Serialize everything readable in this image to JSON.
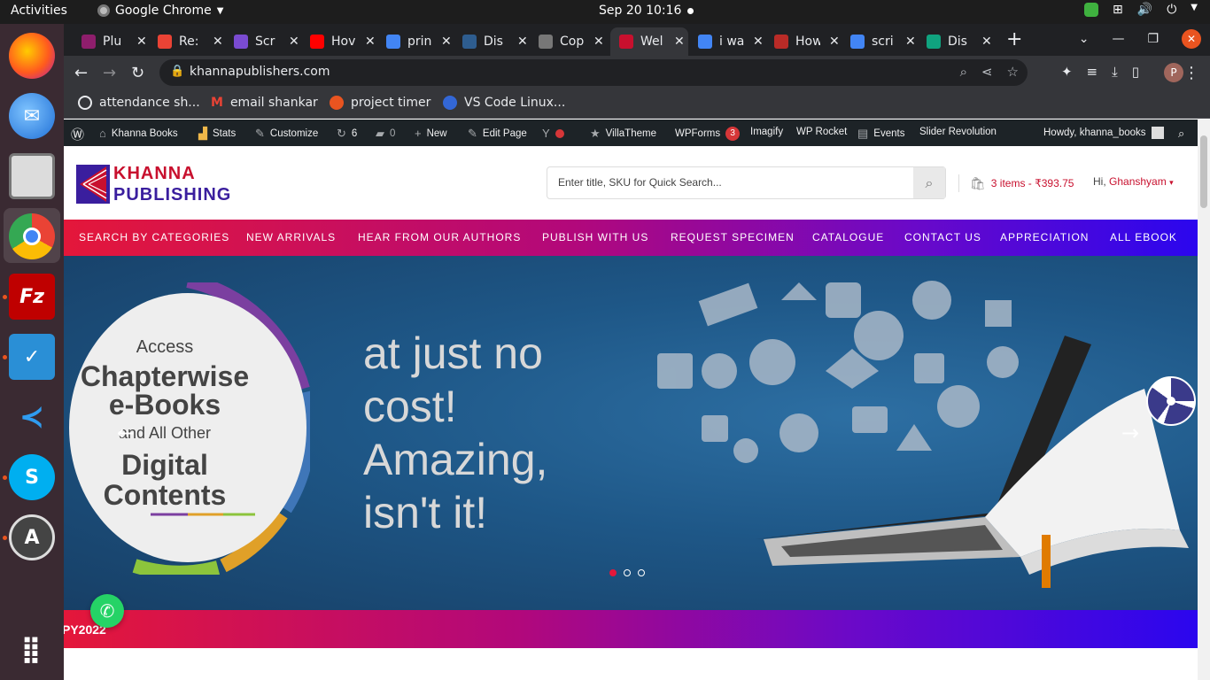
{
  "topbar": {
    "activities": "Activities",
    "app_name": "Google Chrome",
    "datetime": "Sep 20  10:16"
  },
  "tabs": [
    {
      "title": "Plu",
      "color": "#8e1e6c"
    },
    {
      "title": "Re:",
      "color": "#ea4335"
    },
    {
      "title": "Scr",
      "color": "#7a4bd1"
    },
    {
      "title": "Hov",
      "color": "#ff0000"
    },
    {
      "title": "prin",
      "color": "#4285f4"
    },
    {
      "title": "Dis",
      "color": "#2e5d8f"
    },
    {
      "title": "Cop",
      "color": "#777777"
    },
    {
      "title": "Wel",
      "color": "#c8102e"
    },
    {
      "title": "i wa",
      "color": "#4285f4"
    },
    {
      "title": "How",
      "color": "#b92b27"
    },
    {
      "title": "scri",
      "color": "#4285f4"
    },
    {
      "title": "Dis",
      "color": "#10a37f"
    }
  ],
  "toolbar": {
    "url": "khannapublishers.com",
    "profile_initial": "P"
  },
  "bookmarks": [
    {
      "label": "attendance sh...",
      "color": "#e8eaed"
    },
    {
      "label": "email shankar",
      "color": "#ea4335"
    },
    {
      "label": "project timer",
      "color": "#e95420"
    },
    {
      "label": "VS Code Linux...",
      "color": "#3367d6"
    }
  ],
  "wpbar": {
    "site": "Khanna Books",
    "stats": "Stats",
    "customize": "Customize",
    "updates": "6",
    "comments": "0",
    "new": "New",
    "edit_page": "Edit Page",
    "villatheme": "VillaTheme",
    "wpforms": "WPForms",
    "wpforms_count": "3",
    "imagify": "Imagify",
    "wprocket": "WP Rocket",
    "events": "Events",
    "slider": "Slider Revolution",
    "howdy": "Howdy, khanna_books"
  },
  "header": {
    "logo_line1": "KHANNA",
    "logo_line2": "PUBLISHING",
    "search_placeholder": "Enter title, SKU for Quick  Search...",
    "cart": "3 items - ₹393.75",
    "greeting": "Hi,",
    "user": "Ghanshyam"
  },
  "nav": [
    "SEARCH BY CATEGORIES",
    "NEW ARRIVALS",
    "HEAR FROM OUR AUTHORS",
    "PUBLISH WITH US",
    "REQUEST SPECIMEN",
    "CATALOGUE",
    "CONTACT US",
    "APPRECIATION",
    "ALL EBOOK"
  ],
  "hero": {
    "access": "Access",
    "chapterwise": "Chapterwise",
    "ebooks": "e-Books",
    "and_all_other": "and All Other",
    "digital": "Digital",
    "contents": "Contents",
    "tagline1": "at just no",
    "tagline2": "cost!",
    "tagline3": "Amazing,",
    "tagline4": "isn't it!"
  },
  "ribbon": {
    "text": "PY2022"
  }
}
